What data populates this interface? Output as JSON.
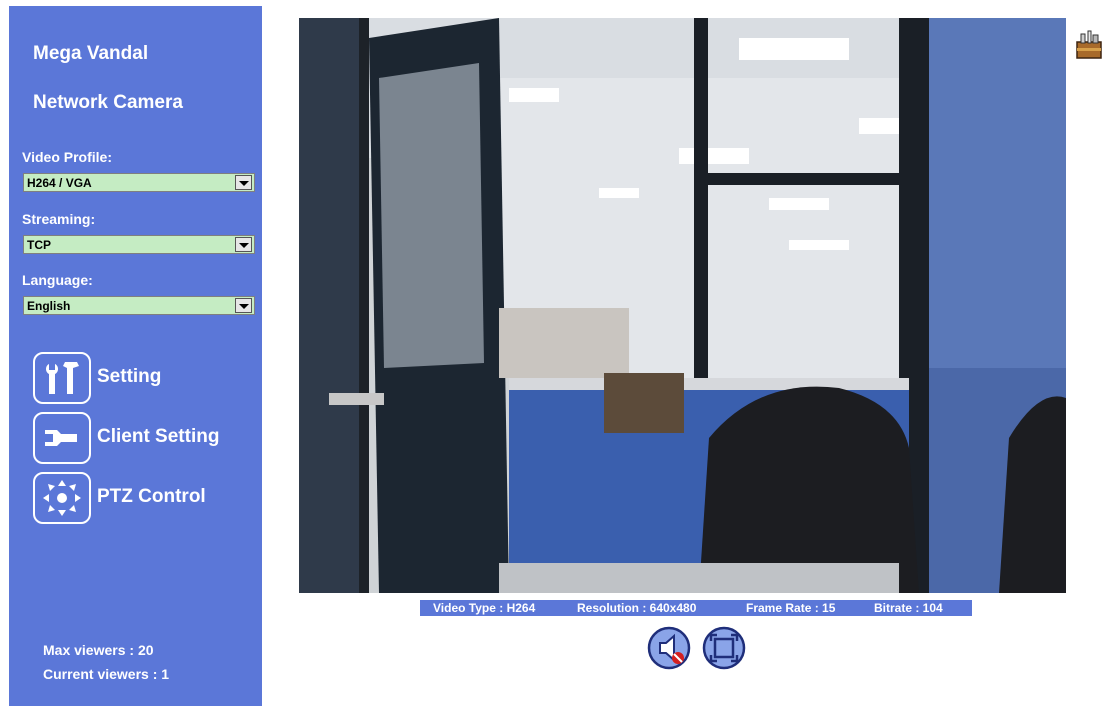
{
  "sidebar": {
    "brand_line1": "Mega Vandal",
    "brand_line2": "Network Camera",
    "video_profile": {
      "label": "Video Profile:",
      "value": "H264 / VGA"
    },
    "streaming": {
      "label": "Streaming:",
      "value": "TCP"
    },
    "language": {
      "label": "Language:",
      "value": "English"
    },
    "menu": [
      {
        "label": "Setting",
        "icon": "tools-icon"
      },
      {
        "label": "Client Setting",
        "icon": "wrench-icon"
      },
      {
        "label": "PTZ Control",
        "icon": "ptz-arrows-icon"
      }
    ],
    "max_viewers": "Max viewers : 20",
    "current_viewers": "Current viewers :  1"
  },
  "status": {
    "video_type": "Video Type : H264",
    "resolution": "Resolution : 640x480",
    "frame_rate": "Frame Rate : 15",
    "bitrate": "Bitrate : 104"
  },
  "controls": {
    "audio": "speaker-muted-icon",
    "fullscreen": "fullscreen-icon",
    "corner": "toolbox-icon"
  },
  "colors": {
    "sidebar": "#5b77d8",
    "select_bg": "#c5ecc3",
    "status_bg": "#5b77d8"
  }
}
